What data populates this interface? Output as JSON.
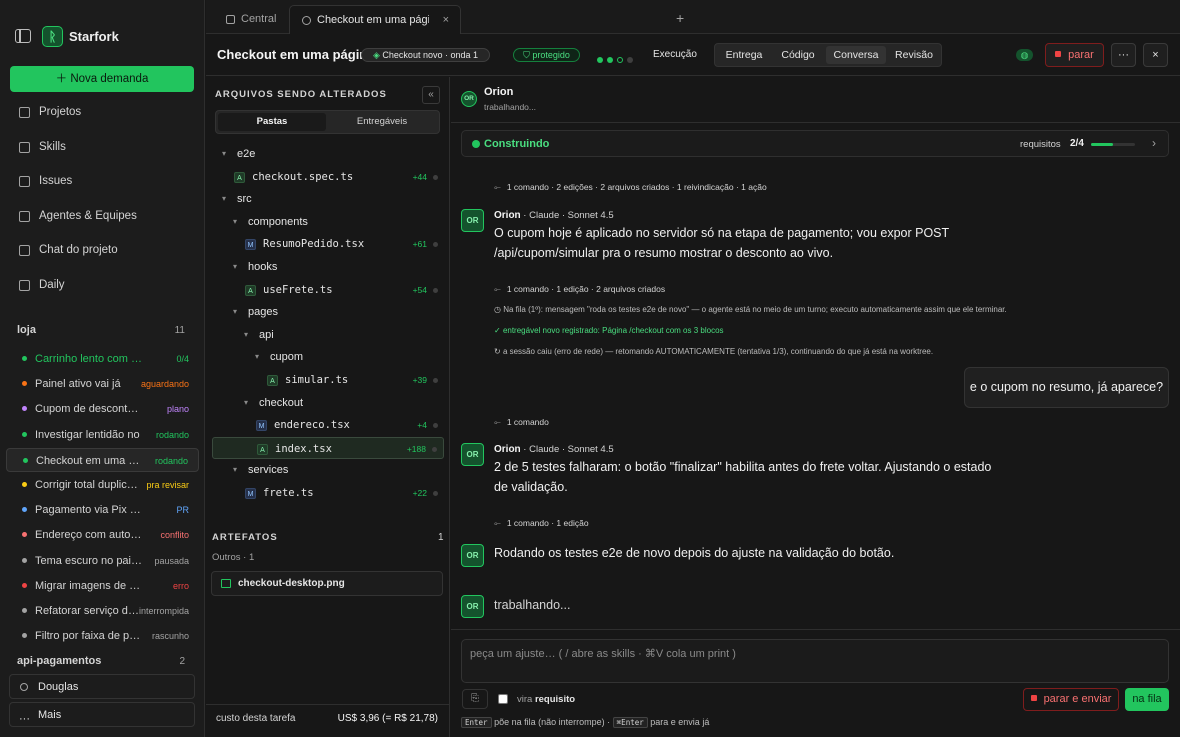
{
  "app": {
    "brand": "Starfork",
    "new_task": "Nova demanda"
  },
  "nav": [
    {
      "label": "Projetos",
      "icon": "folder-icon"
    },
    {
      "label": "Skills",
      "icon": "skills-icon"
    },
    {
      "label": "Issues",
      "icon": "issues-icon"
    },
    {
      "label": "Agentes & Equipes",
      "icon": "people-icon"
    },
    {
      "label": "Chat do projeto",
      "icon": "chat-icon"
    },
    {
      "label": "Daily",
      "icon": "calendar-icon"
    }
  ],
  "group1": {
    "name": "loja",
    "count": "11"
  },
  "tasks": [
    {
      "label": "Carrinho lento com muitos itens",
      "badge": "0/4",
      "color": "#22c55e"
    },
    {
      "label": "Painel ativo vai já",
      "badge": "aguardando",
      "color": "#f97316"
    },
    {
      "label": "Cupom de desconto produto",
      "badge": "plano",
      "color": "#c084fc"
    },
    {
      "label": "Investigar lentidão no",
      "badge": "rodando",
      "color": "#22c55e"
    },
    {
      "label": "Checkout em uma página",
      "badge": "rodando",
      "color": "#22c55e"
    },
    {
      "label": "Corrigir total duplicado",
      "badge": "pra revisar",
      "color": "#facc15"
    },
    {
      "label": "Pagamento via Pix no checkout",
      "badge": "PR",
      "color": "#60a5fa"
    },
    {
      "label": "Endereço com autocomplete",
      "badge": "conflito",
      "color": "#f87171"
    },
    {
      "label": "Tema escuro no painel",
      "badge": "pausada",
      "color": "#a3a3a3"
    },
    {
      "label": "Migrar imagens de produto",
      "badge": "erro",
      "color": "#ef4444"
    },
    {
      "label": "Refatorar serviço de frete",
      "badge": "interrompida",
      "color": "#a3a3a3"
    },
    {
      "label": "Filtro por faixa de preço",
      "badge": "rascunho",
      "color": "#a3a3a3"
    }
  ],
  "group2": {
    "name": "api-pagamentos",
    "count": "2"
  },
  "bottom": {
    "user": "Douglas",
    "more": "Mais"
  },
  "tabs": {
    "t1": "Central",
    "t2": "Checkout em uma página"
  },
  "header": {
    "title": "Checkout em uma página",
    "wave": "Checkout novo · onda 1",
    "protected": "protegido",
    "exec": "Execução",
    "segs": [
      "Entrega",
      "Código",
      "Conversa",
      "Revisão"
    ],
    "stop": "parar"
  },
  "files": {
    "heading": "ARQUIVOS SENDO ALTERADOS",
    "seg_a": "Pastas",
    "seg_b": "Entregáveis",
    "tree": [
      {
        "t": "dir",
        "name": "e2e",
        "d": 0
      },
      {
        "t": "file",
        "name": "checkout.spec.ts",
        "d": 0,
        "b": "A",
        "c": "+44"
      },
      {
        "t": "dir",
        "name": "src",
        "d": 0
      },
      {
        "t": "dir",
        "name": "components",
        "d": 1
      },
      {
        "t": "file",
        "name": "ResumoPedido.tsx",
        "d": 1,
        "b": "M",
        "c": "+61"
      },
      {
        "t": "dir",
        "name": "hooks",
        "d": 1
      },
      {
        "t": "file",
        "name": "useFrete.ts",
        "d": 1,
        "b": "A",
        "c": "+54"
      },
      {
        "t": "dir",
        "name": "pages",
        "d": 1
      },
      {
        "t": "dir",
        "name": "api",
        "d": 2
      },
      {
        "t": "dir",
        "name": "cupom",
        "d": 3
      },
      {
        "t": "file",
        "name": "simular.ts",
        "d": 3,
        "b": "A",
        "c": "+39"
      },
      {
        "t": "dir",
        "name": "checkout",
        "d": 2
      },
      {
        "t": "file",
        "name": "endereco.tsx",
        "d": 2,
        "b": "M",
        "c": "+4"
      },
      {
        "t": "file",
        "name": "index.tsx",
        "d": 2,
        "b": "A",
        "c": "+188",
        "sel": true
      },
      {
        "t": "dir",
        "name": "services",
        "d": 1
      },
      {
        "t": "file",
        "name": "frete.ts",
        "d": 1,
        "b": "M",
        "c": "+22"
      }
    ],
    "art_heading": "ARTEFATOS",
    "art_count": "1",
    "art_sub": "Outros · 1",
    "art_file": "checkout-desktop.png",
    "cost_label": "custo desta tarefa",
    "cost_value": "US$ 3,96 (= R$ 21,78)"
  },
  "chat": {
    "agent": "Orion",
    "status": "trabalhando...",
    "build": {
      "label": "Construindo",
      "req_label": "requisitos",
      "req": "2/4",
      "progress": 0.5
    },
    "meta1": "1 comando · 2 edições · 2 arquivos criados · 1 reivindicação · 1 ação",
    "who": "Orion",
    "model": "Claude · Sonnet 4.5",
    "msg1": "O cupom hoje é aplicado no servidor só na etapa de pagamento; vou expor POST /api/cupom/simular pra o resumo mostrar o desconto ao vivo.",
    "meta2": "1 comando · 1 edição · 2 arquivos criados",
    "note1": "Na fila (1º): mensagem \"roda os testes e2e de novo\" — o agente está no meio de um turno; executo automaticamente assim que ele terminar.",
    "note2": "entregável novo registrado: Página /checkout com os 3 blocos",
    "note3": "a sessão caiu (erro de rede) — retomando AUTOMATICAMENTE (tentativa 1/3), continuando do que já está na worktree.",
    "user_msg": "e o cupom no resumo, já aparece?",
    "meta3": "1 comando",
    "msg2": "2 de 5 testes falharam: o botão \"finalizar\" habilita antes do frete voltar. Ajustando o estado de validação.",
    "meta4": "1 comando · 1 edição",
    "msg3": "Rodando os testes e2e de novo depois do ajuste na validação do botão.",
    "working": "trabalhando...",
    "placeholder": "peça um ajuste…  ( / abre as skills · ⌘V cola um print )",
    "vira": "vira",
    "req_word": "requisito",
    "send": "parar e enviar",
    "queue": "na fila",
    "hint_enter": "Enter",
    "hint1": "põe na fila (não interrompe) ·",
    "hint_ce": "⌘Enter",
    "hint2": "para e envia já"
  }
}
